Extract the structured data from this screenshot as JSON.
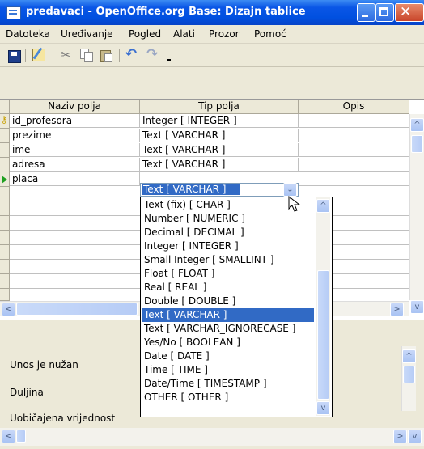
{
  "window": {
    "title": "predavaci - OpenOffice.org Base: Dizajn tablice"
  },
  "menu": [
    "Datoteka",
    "Uređivanje",
    "Pogled",
    "Alati",
    "Prozor",
    "Pomoć"
  ],
  "toolbar": {
    "icons": [
      "save-icon",
      "edit-icon",
      "cut-icon",
      "copy-icon",
      "paste-icon",
      "undo-icon",
      "redo-icon"
    ]
  },
  "table": {
    "headers": {
      "name": "Naziv polja",
      "type": "Tip polja",
      "desc": "Opis"
    },
    "rows": [
      {
        "name": "id_profesora",
        "type": "Integer [ INTEGER ]",
        "primary_key": true
      },
      {
        "name": "prezime",
        "type": "Text [ VARCHAR ]"
      },
      {
        "name": "ime",
        "type": "Text [ VARCHAR ]"
      },
      {
        "name": "adresa",
        "type": "Text [ VARCHAR ]"
      },
      {
        "name": "placa",
        "type": "Text [ VARCHAR ]",
        "current": true
      }
    ]
  },
  "dropdown": {
    "selected": "Text [ VARCHAR ]",
    "options": [
      "Text (fix) [ CHAR ]",
      "Number [ NUMERIC ]",
      "Decimal [ DECIMAL ]",
      "Integer [ INTEGER ]",
      "Small Integer [ SMALLINT ]",
      "Float [ FLOAT ]",
      "Real [ REAL ]",
      "Double [ DOUBLE ]",
      "Text [ VARCHAR ]",
      "Text [ VARCHAR_IGNORECASE ]",
      "Yes/No [ BOOLEAN ]",
      "Date [ DATE ]",
      "Time [ TIME ]",
      "Date/Time [ TIMESTAMP ]",
      "OTHER [ OTHER ]"
    ]
  },
  "properties": {
    "required_label": "Unos je nužan",
    "length_label": "Duljina",
    "default_label": "Uobičajena vrijednost"
  },
  "colors": {
    "titlebar": "#0A56E6",
    "selection": "#316AC5"
  }
}
